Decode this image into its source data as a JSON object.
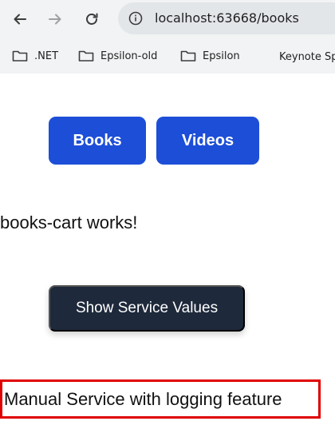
{
  "browser": {
    "url": "localhost:63668/books",
    "bookmarks": [
      {
        "label": ".NET",
        "icon": "folder-icon"
      },
      {
        "label": "Epsilon-old",
        "icon": "folder-icon"
      },
      {
        "label": "Epsilon",
        "icon": "folder-icon"
      },
      {
        "label": "Keynote Sp",
        "icon": null
      }
    ]
  },
  "nav": {
    "books_label": "Books",
    "videos_label": "Videos"
  },
  "content": {
    "works_text": "books-cart works!",
    "show_values_label": "Show Service Values",
    "service_message": "Manual Service with logging feature"
  },
  "colors": {
    "nav_button": "#1d4ed8",
    "dark_button": "#1e293b",
    "highlight_border": "#e00000"
  }
}
